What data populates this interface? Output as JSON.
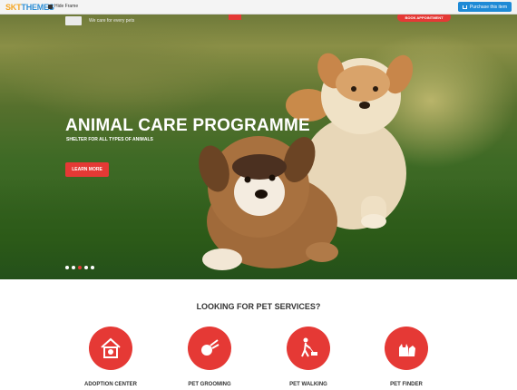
{
  "frame": {
    "logo_sk": "SKT",
    "logo_themes": "THEMES",
    "hide_frame": "Hide Frame",
    "purchase": "Purchase this item"
  },
  "header": {
    "tagline": "We care for every pets",
    "book_button": "BOOK APPOINTMENT"
  },
  "hero": {
    "title": "ANIMAL CARE PROGRAMME",
    "subtitle": "SHELTER FOR ALL TYPES OF ANIMALS",
    "button": "LEARN MORE",
    "slides": 5,
    "active_slide": 3
  },
  "services": {
    "heading": "LOOKING FOR PET SERVICES?",
    "items": [
      {
        "label": "ADOPTION CENTER",
        "icon": "house-pet-icon"
      },
      {
        "label": "PET GROOMING",
        "icon": "grooming-icon"
      },
      {
        "label": "PET WALKING",
        "icon": "walking-icon"
      },
      {
        "label": "PET FINDER",
        "icon": "cat-dog-icon"
      }
    ]
  },
  "colors": {
    "accent": "#e53935",
    "frame_blue": "#1e8ad6"
  }
}
